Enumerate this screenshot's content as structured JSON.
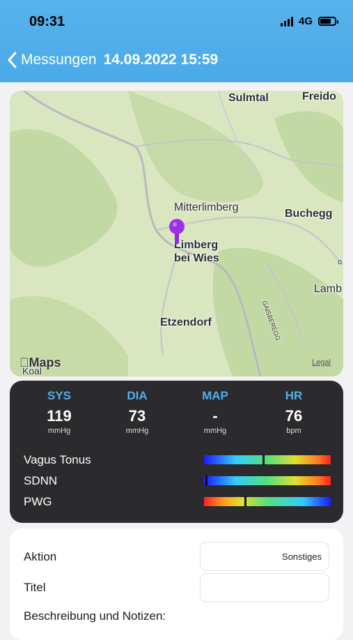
{
  "status_bar": {
    "time": "09:31",
    "network": "4G"
  },
  "nav": {
    "back_label": "Messungen",
    "title": "14.09.2022 15:59"
  },
  "map": {
    "places": {
      "sulmtal": "Sulmtal",
      "freidorf": "Freido",
      "mitterlimberg": "Mitterlimberg",
      "buchegg": "Buchegg",
      "limberg_line1": "Limberg",
      "limberg_line2": "bei Wies",
      "lamb": "Lamb",
      "etzendorf": "Etzendorf",
      "koal": "Koal",
      "gaisberegg": "GAISBEREGG",
      "edge_o": "o"
    },
    "brand": "Maps",
    "legal": "Legal",
    "pin_color": "#8a2be2"
  },
  "metrics": {
    "items": [
      {
        "label": "SYS",
        "value": "119",
        "unit": "mmHg"
      },
      {
        "label": "DIA",
        "value": "73",
        "unit": "mmHg"
      },
      {
        "label": "MAP",
        "value": "-",
        "unit": "mmHg"
      },
      {
        "label": "HR",
        "value": "76",
        "unit": "bpm"
      }
    ],
    "indicators": [
      {
        "label": "Vagus Tonus",
        "marker": 0.46
      },
      {
        "label": "SDNN",
        "marker": 0.01
      },
      {
        "label": "PWG",
        "marker": 0.32
      }
    ],
    "accent_color": "#4fb0ee"
  },
  "form": {
    "action_label": "Aktion",
    "action_value": "Sonstiges",
    "title_label": "Titel",
    "title_value": "",
    "description_label": "Beschreibung und Notizen:"
  }
}
